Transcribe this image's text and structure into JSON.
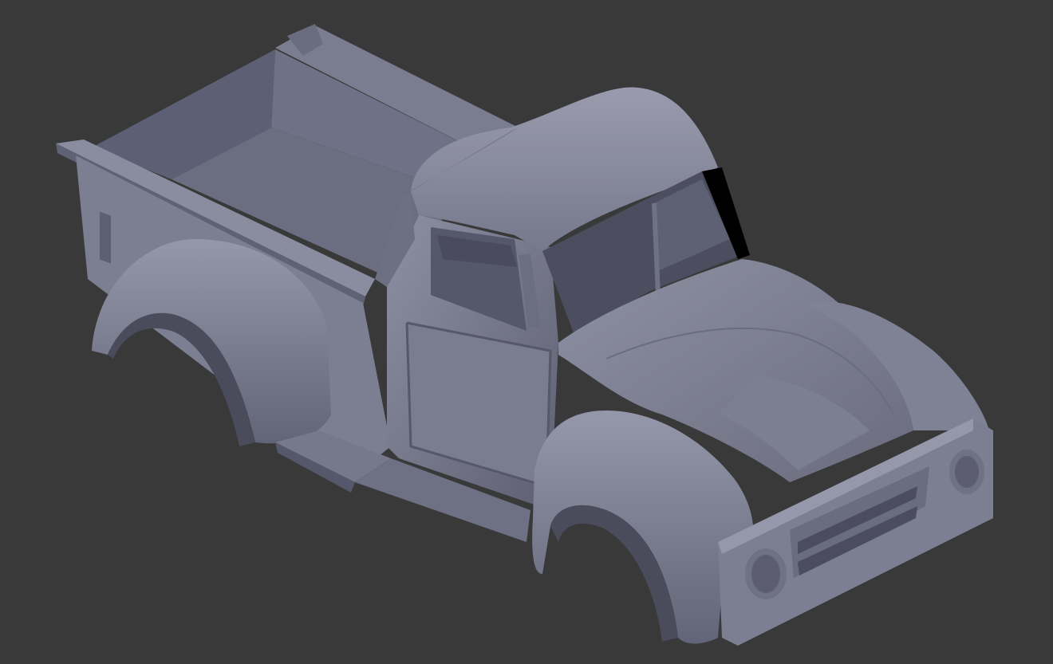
{
  "viewport": {
    "background": "#393939",
    "subject": "pickup-truck-body-3d-model",
    "shading": "solid-gray-matcap"
  },
  "colors": {
    "body_light": "#8a8ca0",
    "body_mid": "#74768a",
    "body_dark": "#585a6c",
    "shadow": "#454656",
    "highlight": "#9c9eb0"
  }
}
